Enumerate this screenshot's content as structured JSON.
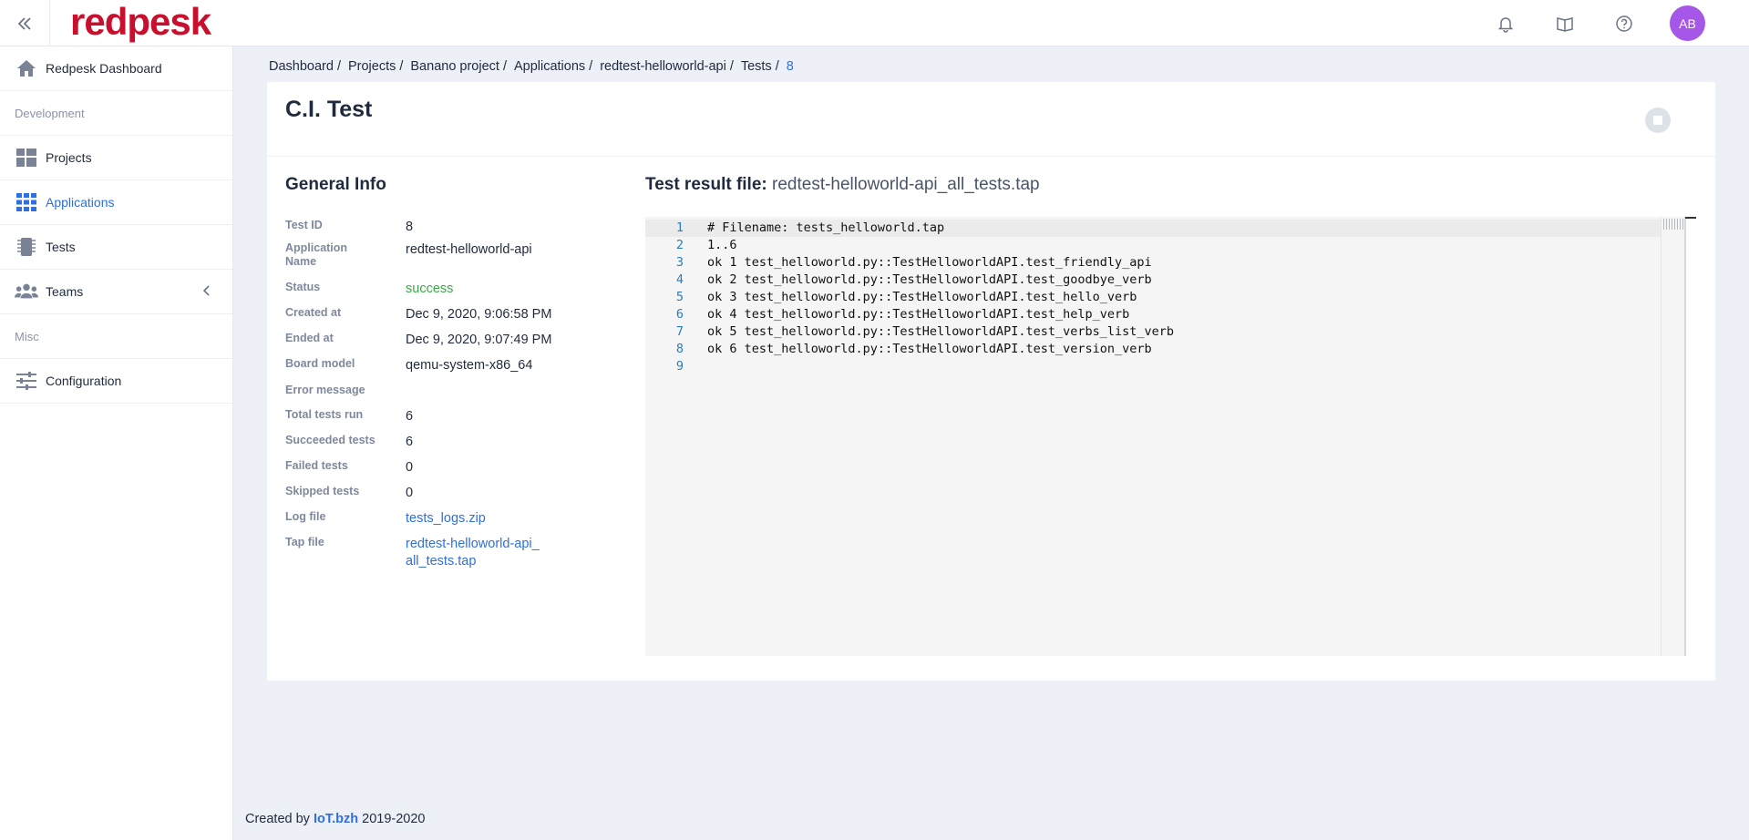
{
  "app": {
    "logo_text": "redpesk",
    "brand_color": "#c8102e",
    "accent_color": "#2f6fe0"
  },
  "topbar": {
    "collapse_icon": "double-chevron-left-icon",
    "icons": [
      "bell-icon",
      "book-icon",
      "help-circle-icon"
    ],
    "avatar_initials": "AB",
    "avatar_color": "#a557e8"
  },
  "sidebar": {
    "items": [
      {
        "label": "Redpesk Dashboard",
        "icon": "home-icon"
      },
      {
        "section": "Development"
      },
      {
        "label": "Projects",
        "icon": "grid-icon"
      },
      {
        "label": "Applications",
        "icon": "apps-icon",
        "active": true
      },
      {
        "label": "Tests",
        "icon": "chip-icon"
      },
      {
        "label": "Teams",
        "icon": "users-icon"
      },
      {
        "section": "Misc"
      },
      {
        "label": "Configuration",
        "icon": "sliders-icon"
      }
    ]
  },
  "breadcrumb": [
    "Dashboard",
    "Projects",
    "Banano project",
    "Applications",
    "redtest-helloworld-api",
    "Tests",
    "8"
  ],
  "page_title": "C.I. Test",
  "general_info": {
    "title": "General Info",
    "rows": [
      {
        "label": "Test ID",
        "value": "8"
      },
      {
        "label": "Application Name",
        "value": "redtest-helloworld-api"
      },
      {
        "label": "Status",
        "value": "success"
      },
      {
        "label": "Created at",
        "value": "Dec 9, 2020, 9:06:58 PM"
      },
      {
        "label": "Ended at",
        "value": "Dec 9, 2020, 9:07:49 PM"
      },
      {
        "label": "Board model",
        "value": "qemu-system-x86_64"
      },
      {
        "label": "Error message",
        "value": ""
      },
      {
        "label": "Total tests run",
        "value": "6"
      },
      {
        "label": "Succeeded tests",
        "value": "6"
      },
      {
        "label": "Failed tests",
        "value": "0"
      },
      {
        "label": "Skipped tests",
        "value": "0"
      },
      {
        "label": "Log file",
        "value": "tests_logs.zip"
      },
      {
        "label": "Tap file",
        "value": "redtest-helloworld-api_all_tests.tap"
      }
    ]
  },
  "test_result": {
    "label": "Test result file:",
    "filename": "redtest-helloworld-api_all_tests.tap",
    "lines": [
      "# Filename: tests_helloworld.tap",
      "1..6",
      "ok 1 test_helloworld.py::TestHelloworldAPI.test_friendly_api",
      "ok 2 test_helloworld.py::TestHelloworldAPI.test_goodbye_verb",
      "ok 3 test_helloworld.py::TestHelloworldAPI.test_hello_verb",
      "ok 4 test_helloworld.py::TestHelloworldAPI.test_help_verb",
      "ok 5 test_helloworld.py::TestHelloworldAPI.test_verbs_list_verb",
      "ok 6 test_helloworld.py::TestHelloworldAPI.test_version_verb",
      ""
    ],
    "line_numbers": [
      "1",
      "2",
      "3",
      "4",
      "5",
      "6",
      "7",
      "8",
      "9"
    ]
  },
  "footer": {
    "prefix": "Created by",
    "brand": "IoT.bzh",
    "years": "2019-2020"
  }
}
